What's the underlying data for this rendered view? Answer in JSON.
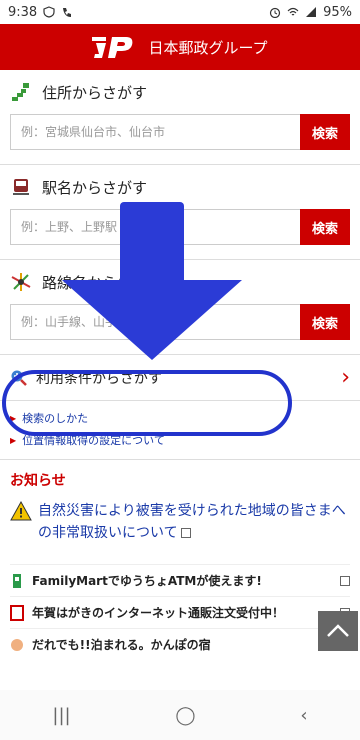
{
  "status_bar": {
    "time": "9:38",
    "battery": "95%"
  },
  "header": {
    "brand": "日本郵政グループ"
  },
  "sections": [
    {
      "title": "住所からさがす",
      "placeholder": "例：宮城県仙台市、仙台市",
      "button": "検索"
    },
    {
      "title": "駅名からさがす",
      "placeholder": "例：上野、上野駅",
      "button": "検索"
    },
    {
      "title": "路線名からさがす",
      "placeholder": "例：山手線、山手",
      "button": "検索"
    }
  ],
  "condition": {
    "label": "利用条件からさがす"
  },
  "links": [
    "検索のしかた",
    "位置情報取得の設定について"
  ],
  "news": {
    "title": "お知らせ",
    "alert": "自然災害により被害を受けられた地域の皆さまへの非常取扱いについて",
    "items": [
      "FamilyMartでゆうちょATMが使えます!",
      "年賀はがきのインターネット通販注文受付中！",
      "だれでも!!泊まれる。かんぽの宿"
    ]
  },
  "colors": {
    "brand_red": "#cc0000",
    "link_blue": "#1a3aa8",
    "annotation_blue": "#2233cc"
  }
}
